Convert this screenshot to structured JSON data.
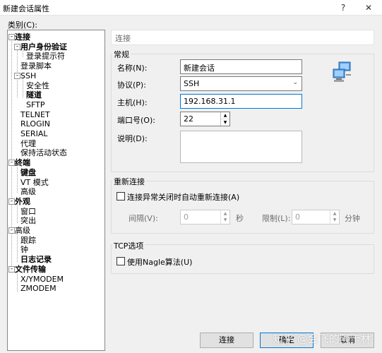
{
  "window": {
    "title": "新建会话属性",
    "help": "?",
    "close": "✕"
  },
  "category_label": "类别(C):",
  "tree": [
    {
      "label": "连接",
      "bold": true
    },
    {
      "label": "用户身份验证",
      "bold": true
    },
    {
      "label": "登录提示符",
      "bold": false
    },
    {
      "label": "登录脚本",
      "bold": false
    },
    {
      "label": "SSH",
      "bold": false
    },
    {
      "label": "安全性",
      "bold": false
    },
    {
      "label": "隧道",
      "bold": true
    },
    {
      "label": "SFTP",
      "bold": false
    },
    {
      "label": "TELNET",
      "bold": false
    },
    {
      "label": "RLOGIN",
      "bold": false
    },
    {
      "label": "SERIAL",
      "bold": false
    },
    {
      "label": "代理",
      "bold": false
    },
    {
      "label": "保持活动状态",
      "bold": false
    },
    {
      "label": "终端",
      "bold": true
    },
    {
      "label": "键盘",
      "bold": true
    },
    {
      "label": "VT 模式",
      "bold": false
    },
    {
      "label": "高级",
      "bold": false
    },
    {
      "label": "外观",
      "bold": true
    },
    {
      "label": "窗口",
      "bold": false
    },
    {
      "label": "突出",
      "bold": false
    },
    {
      "label": "高级",
      "bold": false
    },
    {
      "label": "跟踪",
      "bold": false
    },
    {
      "label": "钟",
      "bold": false
    },
    {
      "label": "日志记录",
      "bold": true
    },
    {
      "label": "文件传输",
      "bold": true
    },
    {
      "label": "X/YMODEM",
      "bold": false
    },
    {
      "label": "ZMODEM",
      "bold": false
    }
  ],
  "panel": {
    "header": "连接",
    "general": {
      "legend": "常规",
      "name_label": "名称(N):",
      "name_value": "新建会话",
      "protocol_label": "协议(P):",
      "protocol_value": "SSH",
      "host_label": "主机(H):",
      "host_value": "192.168.31.1",
      "port_label": "端口号(O):",
      "port_value": "22",
      "desc_label": "说明(D):",
      "desc_value": ""
    },
    "reconnect": {
      "legend": "重新连接",
      "checkbox_label": "连接异常关闭时自动重新连接(A)",
      "interval_label": "间隔(V):",
      "interval_value": "0",
      "interval_unit": "秒",
      "limit_label": "限制(L):",
      "limit_value": "0",
      "limit_unit": "分钟"
    },
    "tcp": {
      "legend": "TCP选项",
      "nagle_label": "使用Nagle算法(U)"
    }
  },
  "buttons": {
    "connect": "连接",
    "ok": "确定",
    "cancel": "取消"
  },
  "watermark": "知乎 @会飞的阿卡林"
}
